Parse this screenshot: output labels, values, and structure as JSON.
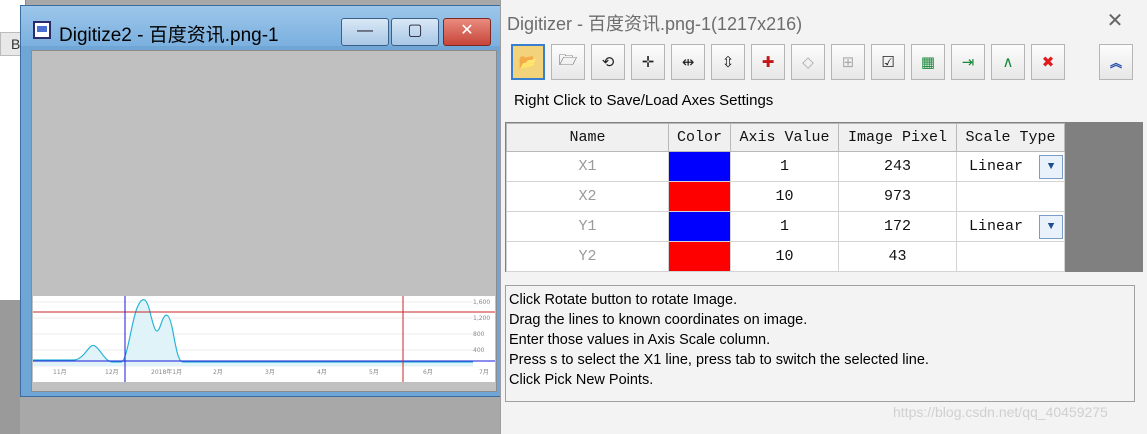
{
  "background_app": {
    "header_letter": "B"
  },
  "digitize_window": {
    "title": "Digitize2 - 百度资讯.png-1",
    "buttons": {
      "minimize": "—",
      "maximize": "▢",
      "close": "✕"
    },
    "plot": {
      "y_ticks": [
        "1,600",
        "1,200",
        "800",
        "400"
      ],
      "x_ticks": [
        "11月",
        "12月",
        "2018年1月",
        "2月",
        "3月",
        "4月",
        "5月",
        "6月",
        "7月"
      ]
    }
  },
  "digitizer": {
    "title": "Digitizer - 百度资讯.png-1(1217x216)",
    "close_glyph": "✕",
    "hint": "Right Click to Save/Load Axes Settings",
    "toolbar": [
      {
        "icon": "open-folder-icon",
        "glyph": "📂"
      },
      {
        "icon": "open-image-icon",
        "glyph": "🗁"
      },
      {
        "icon": "rotate-icon",
        "glyph": "⟲"
      },
      {
        "icon": "axes-crosshair-icon",
        "glyph": "✛"
      },
      {
        "icon": "x-axis-lines-icon",
        "glyph": "⇹"
      },
      {
        "icon": "y-axis-lines-icon",
        "glyph": "⇳"
      },
      {
        "icon": "pick-points-icon",
        "glyph": "✚"
      },
      {
        "icon": "eraser-icon",
        "glyph": "◇"
      },
      {
        "icon": "data-settings-icon",
        "glyph": "⊞"
      },
      {
        "icon": "checklist-icon",
        "glyph": "☑"
      },
      {
        "icon": "go-to-data-icon",
        "glyph": "▦"
      },
      {
        "icon": "insert-data-icon",
        "glyph": "⇥"
      },
      {
        "icon": "plot-data-icon",
        "glyph": "∧"
      },
      {
        "icon": "delete-icon",
        "glyph": "✖"
      }
    ],
    "expand_glyph": "︽",
    "table": {
      "headers": [
        "Name",
        "Color",
        "Axis Value",
        "Image Pixel",
        "Scale Type"
      ],
      "rows": [
        {
          "name": "X1",
          "color": "#0000ff",
          "axis_value": "1",
          "image_pixel": "243",
          "scale": "Linear"
        },
        {
          "name": "X2",
          "color": "#ff0000",
          "axis_value": "10",
          "image_pixel": "973",
          "scale": ""
        },
        {
          "name": "Y1",
          "color": "#0000ff",
          "axis_value": "1",
          "image_pixel": "172",
          "scale": "Linear"
        },
        {
          "name": "Y2",
          "color": "#ff0000",
          "axis_value": "10",
          "image_pixel": "43",
          "scale": ""
        }
      ]
    },
    "instructions": [
      "Click Rotate button to rotate Image.",
      "Drag the lines to known coordinates on image.",
      "Enter those values in Axis Scale column.",
      "Press s to select the X1 line, press tab to switch the selected line.",
      "Click Pick New Points."
    ]
  },
  "watermark": "https://blog.csdn.net/qq_40459275"
}
